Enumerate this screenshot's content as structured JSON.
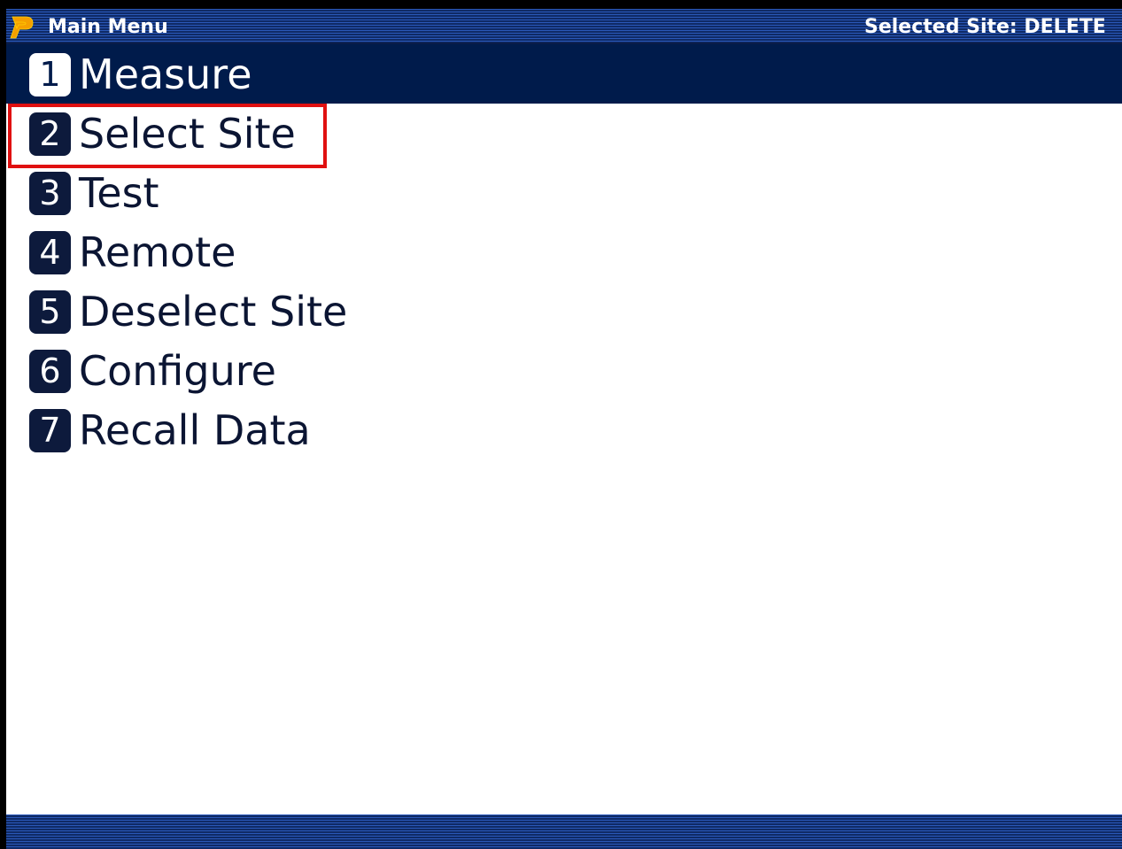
{
  "titlebar": {
    "title": "Main Menu",
    "site_status": "Selected Site: DELETE",
    "logo_icon": "p-logo-icon",
    "colors": {
      "bar": "#0f2a66",
      "stripe": "#2a58b8",
      "logo": "#f5a000"
    }
  },
  "menu": {
    "selected_index": 0,
    "highlighted_index": 1,
    "highlight_color": "#e01010",
    "items": [
      {
        "key": "1",
        "label": "Measure"
      },
      {
        "key": "2",
        "label": "Select Site"
      },
      {
        "key": "3",
        "label": "Test"
      },
      {
        "key": "4",
        "label": "Remote"
      },
      {
        "key": "5",
        "label": "Deselect Site"
      },
      {
        "key": "6",
        "label": "Configure"
      },
      {
        "key": "7",
        "label": "Recall Data"
      }
    ]
  }
}
